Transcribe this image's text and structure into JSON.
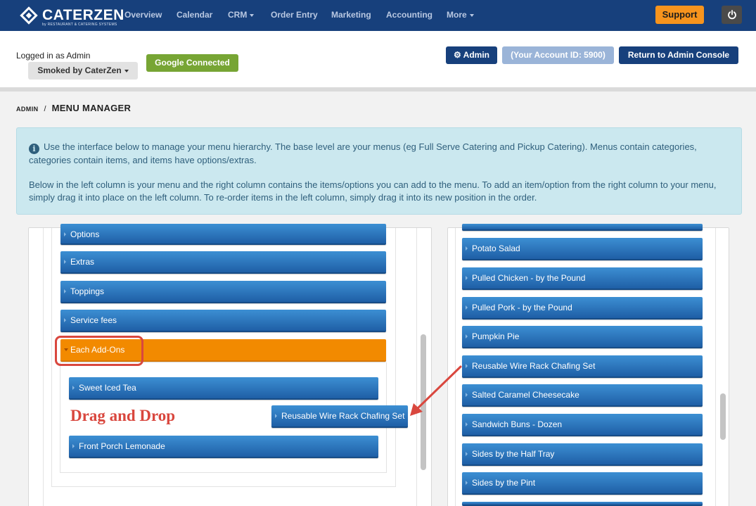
{
  "nav": {
    "logo_text": "CATERZEN",
    "logo_subtitle": "by RESTAURANT & CATERING SYSTEMS",
    "items": [
      {
        "label": "Overview"
      },
      {
        "label": "Calendar"
      },
      {
        "label": "CRM"
      },
      {
        "label": "Order Entry"
      },
      {
        "label": "Marketing"
      },
      {
        "label": "Accounting"
      },
      {
        "label": "More"
      }
    ],
    "support_label": "Support",
    "power_icon": "power-icon"
  },
  "header": {
    "logged_in_text": "Logged in as Admin",
    "account_selector": "Smoked by CaterZen",
    "google_label": "Google Connected",
    "admin_label": "Admin",
    "account_id_label": "(Your Account ID: 5900)",
    "return_label": "Return to Admin Console"
  },
  "breadcrumb": {
    "root": "ADMIN",
    "separator": "/",
    "current": "MENU MANAGER"
  },
  "info": {
    "paragraph1": "Use the interface below to manage your menu hierarchy. The base level are your menus (eg Full Serve Catering and Pickup Catering). Menus contain categories, categories contain items, and items have options/extras.",
    "paragraph2": "Below in the left column is your menu and the right column contains the items/options you can add to the menu. To add an item/option from the right column to your menu, simply drag it into place on the left column. To re-order items in the left column, simply drag it into its new position in the order."
  },
  "left_panel": {
    "categories": [
      {
        "label": "Options"
      },
      {
        "label": "Extras"
      },
      {
        "label": "Toppings"
      },
      {
        "label": "Service fees"
      },
      {
        "label": "Each Add-Ons"
      }
    ],
    "sub_items": [
      {
        "label": "Sweet Iced Tea"
      },
      {
        "label": "Front Porch Lemonade"
      }
    ],
    "dragging_item": "Reusable Wire Rack Chafing Set",
    "annotation": "Drag and Drop"
  },
  "right_panel": {
    "items": [
      {
        "label": "Potato Salad"
      },
      {
        "label": "Pulled Chicken - by the Pound"
      },
      {
        "label": "Pulled Pork - by the Pound"
      },
      {
        "label": "Pumpkin Pie"
      },
      {
        "label": "Reusable Wire Rack Chafing Set"
      },
      {
        "label": "Salted Caramel Cheesecake"
      },
      {
        "label": "Sandwich Buns - Dozen"
      },
      {
        "label": "Sides by the Half Tray"
      },
      {
        "label": "Sides by the Pint"
      }
    ]
  },
  "colors": {
    "nav_bg": "#17407c",
    "accent_orange": "#f28a00",
    "support_orange": "#f7941d",
    "google_green": "#77a534",
    "item_blue": "#1f5fa6",
    "annotation_red": "#d9473e",
    "info_bg": "#cbe8ef"
  }
}
